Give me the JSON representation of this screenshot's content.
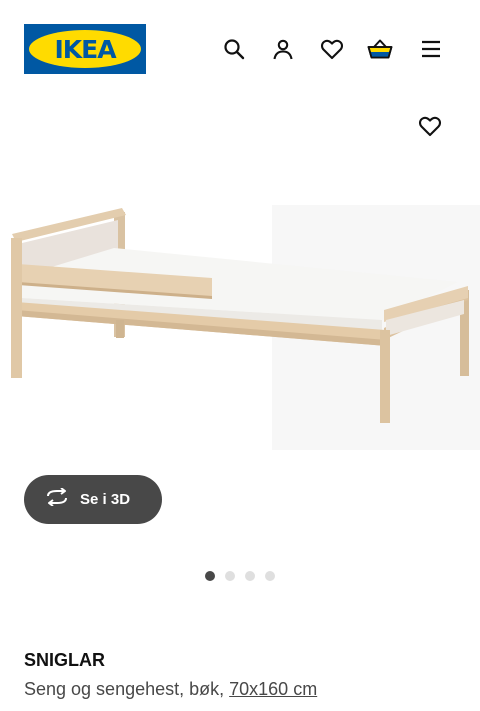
{
  "header": {
    "logo_text": "IKEA",
    "icons": [
      "search-icon",
      "user-icon",
      "heart-icon",
      "basket-icon",
      "menu-icon"
    ]
  },
  "product": {
    "name": "SNIGLAR",
    "description": "Seng og sengehest, bøk, ",
    "size_link": "70x160 cm",
    "view_3d_label": "Se i 3D",
    "image_count": 4,
    "active_image_index": 0
  },
  "colors": {
    "brand_blue": "#0058a3",
    "brand_yellow": "#ffdb00",
    "button_dark": "#484848",
    "dot_inactive": "#dfdfdf"
  }
}
